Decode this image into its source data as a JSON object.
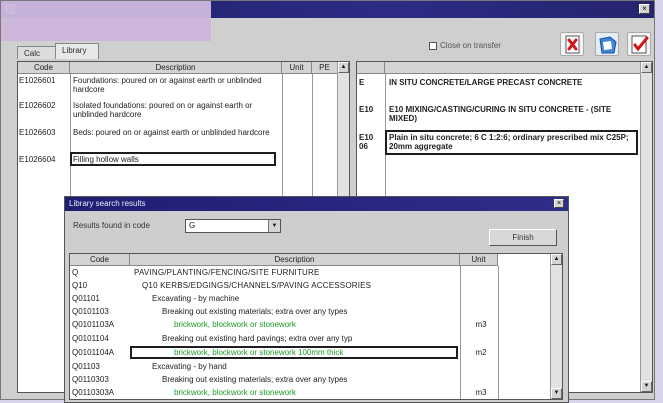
{
  "window": {
    "close_glyph": "×"
  },
  "tabs": [
    {
      "label": "Calc"
    },
    {
      "label": "Library"
    }
  ],
  "toolbar": {
    "checkbox_label": "Close on transfer",
    "buttons": [
      {
        "name": "cancel-button",
        "icon": "red-x-icon"
      },
      {
        "name": "transfer-button",
        "icon": "blue-document-icon"
      },
      {
        "name": "accept-button",
        "icon": "red-check-icon"
      }
    ]
  },
  "library_table": {
    "columns": [
      "Code",
      "Description",
      "Unit",
      "PE"
    ],
    "rows": [
      {
        "code": "E1026601",
        "desc": "Foundations: poured on or against earth or unblinded hardcore"
      },
      {
        "code": "E1026602",
        "desc": "Isolated foundations: poured on or against earth or unblinded hardcore"
      },
      {
        "code": "E1026603",
        "desc": "Beds: poured on or against earth or unblinded hardcore"
      },
      {
        "code": "E1026604",
        "desc": "Filling hollow walls"
      }
    ]
  },
  "right_table": {
    "rows": [
      {
        "code": "E",
        "desc": "IN SITU CONCRETE/LARGE PRECAST CONCRETE"
      },
      {
        "code": "E10",
        "desc": "E10 MIXING/CASTING/CURING IN SITU CONCRETE - (SITE MIXED)"
      },
      {
        "code": "E10 06",
        "desc": "Plain in situ concrete; 6 C 1:2:6; ordinary prescribed mix C25P; 20mm aggregate"
      }
    ]
  },
  "dialog": {
    "title": "Library search results",
    "results_label": "Results found in code",
    "results_value": "G",
    "button_label": "Finish",
    "close_glyph": "×",
    "columns": [
      "Code",
      "Description",
      "Unit"
    ],
    "rows": [
      {
        "code": "Q",
        "desc": "PAVING/PLANTING/FENCING/SITE FURNITURE",
        "unit": ""
      },
      {
        "code": "Q10",
        "desc": "Q10 KERBS/EDGINGS/CHANNELS/PAVING ACCESSORIES",
        "unit": ""
      },
      {
        "code": "Q01101",
        "desc": "Excavating - by machine",
        "unit": ""
      },
      {
        "code": "Q0101103",
        "desc": "Breaking out existing materials; extra over any types",
        "unit": ""
      },
      {
        "code": "Q0101103A",
        "desc": "brickwork, blockwork or stonework",
        "unit": "m3"
      },
      {
        "code": "Q0101104",
        "desc": "Breaking out existing hard pavings; extra over any typ",
        "unit": ""
      },
      {
        "code": "Q0101104A",
        "desc": "brickwork, blockwork or stonework 100mm thick",
        "unit": "m2"
      },
      {
        "code": "Q01103",
        "desc": "Excavating - by hand",
        "unit": ""
      },
      {
        "code": "Q0110303",
        "desc": "Breaking out existing materials; extra over any types",
        "unit": ""
      },
      {
        "code": "Q0110303A",
        "desc": "brickwork, blockwork or stonework",
        "unit": "m3"
      }
    ]
  },
  "colors": {
    "titlebar": "#24246f",
    "green_text": "#1d9b27",
    "lilac_band": "#cdb7dd"
  }
}
